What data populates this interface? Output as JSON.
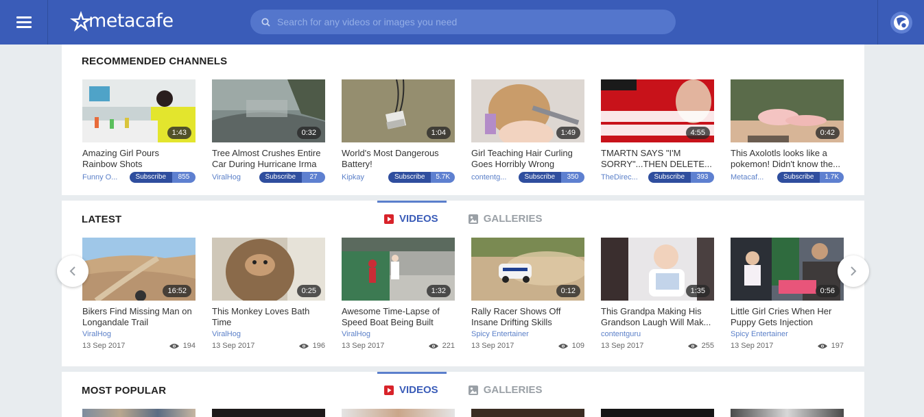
{
  "header": {
    "logo_text": "metacafe",
    "search_placeholder": "Search for any videos or images you need",
    "brand_color": "#3a5cb8"
  },
  "channels": {
    "title": "RECOMMENDED CHANNELS",
    "items": [
      {
        "duration": "1:43",
        "title": "Amazing Girl Pours Rainbow Shots",
        "channel": "Funny O...",
        "subscribe": "Subscribe",
        "count": "855"
      },
      {
        "duration": "0:32",
        "title": "Tree Almost Crushes Entire Car During Hurricane Irma",
        "channel": "ViralHog",
        "subscribe": "Subscribe",
        "count": "27"
      },
      {
        "duration": "1:04",
        "title": "World's Most Dangerous Battery!",
        "channel": "Kipkay",
        "subscribe": "Subscribe",
        "count": "5.7K"
      },
      {
        "duration": "1:49",
        "title": "Girl Teaching Hair Curling Goes Horribly Wrong",
        "channel": "contentg...",
        "subscribe": "Subscribe",
        "count": "350"
      },
      {
        "duration": "4:55",
        "title": "TMARTN SAYS \"I'M SORRY\"...THEN DELETE...",
        "channel": "TheDirec...",
        "subscribe": "Subscribe",
        "count": "393"
      },
      {
        "duration": "0:42",
        "title": "This Axolotls looks like a pokemon! Didn't know the...",
        "channel": "Metacaf...",
        "subscribe": "Subscribe",
        "count": "1.7K"
      }
    ]
  },
  "latest": {
    "title": "LATEST",
    "tab_videos": "VIDEOS",
    "tab_galleries": "GALLERIES",
    "items": [
      {
        "duration": "16:52",
        "title": "Bikers Find Missing Man on Longandale Trail",
        "channel": "ViralHog",
        "date": "13 Sep 2017",
        "views": "194"
      },
      {
        "duration": "0:25",
        "title": "This Monkey Loves Bath Time",
        "channel": "ViralHog",
        "date": "13 Sep 2017",
        "views": "196"
      },
      {
        "duration": "1:32",
        "title": "Awesome Time-Lapse of Speed Boat Being Built",
        "channel": "ViralHog",
        "date": "13 Sep 2017",
        "views": "221"
      },
      {
        "duration": "0:12",
        "title": "Rally Racer Shows Off Insane Drifting Skills",
        "channel": "Spicy Entertainer",
        "date": "13 Sep 2017",
        "views": "109"
      },
      {
        "duration": "1:35",
        "title": "This Grandpa Making His Grandson Laugh Will Mak...",
        "channel": "contentguru",
        "date": "13 Sep 2017",
        "views": "255"
      },
      {
        "duration": "0:56",
        "title": "Little Girl Cries When Her Puppy Gets Injection",
        "channel": "Spicy Entertainer",
        "date": "13 Sep 2017",
        "views": "197"
      }
    ]
  },
  "popular": {
    "title": "MOST POPULAR",
    "tab_videos": "VIDEOS",
    "tab_galleries": "GALLERIES"
  }
}
